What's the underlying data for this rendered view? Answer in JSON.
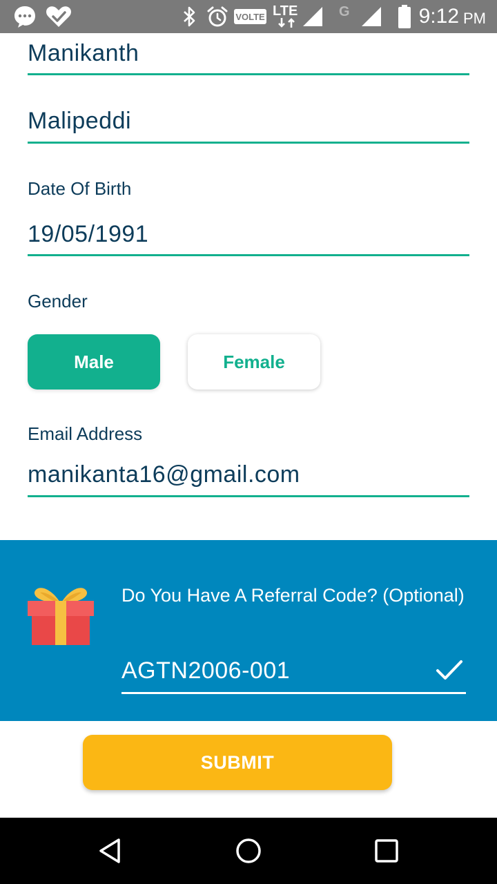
{
  "status_bar": {
    "time": "9:12",
    "ampm": "PM",
    "volte": "VOLTE",
    "lte": "LTE",
    "g": "G",
    "icons": [
      "chat-bubble-icon",
      "heart-check-icon",
      "bluetooth-icon",
      "alarm-icon",
      "signal-icon",
      "battery-icon"
    ]
  },
  "form": {
    "first_name": "Manikanth",
    "last_name": "Malipeddi",
    "dob_label": "Date Of Birth",
    "dob_value": "19/05/1991",
    "gender_label": "Gender",
    "gender_options": [
      "Male",
      "Female"
    ],
    "gender_selected": "Male",
    "email_label": "Email Address",
    "email_value": "manikanta16@gmail.com"
  },
  "referral": {
    "question": "Do You Have A Referral Code? (Optional)",
    "code": "AGTN2006-001",
    "icon": "gift-icon",
    "check_icon": "check-icon"
  },
  "submit": {
    "label": "SUBMIT"
  },
  "nav": {
    "icons": [
      "back-icon",
      "home-icon",
      "recents-icon"
    ]
  },
  "colors": {
    "status_bar": "#7a7a7a",
    "text_dark": "#0d3c5a",
    "accent_green": "#12b08e",
    "referral_bg": "#0087bd",
    "submit_bg": "#fbb714",
    "nav_bg": "#000000"
  }
}
